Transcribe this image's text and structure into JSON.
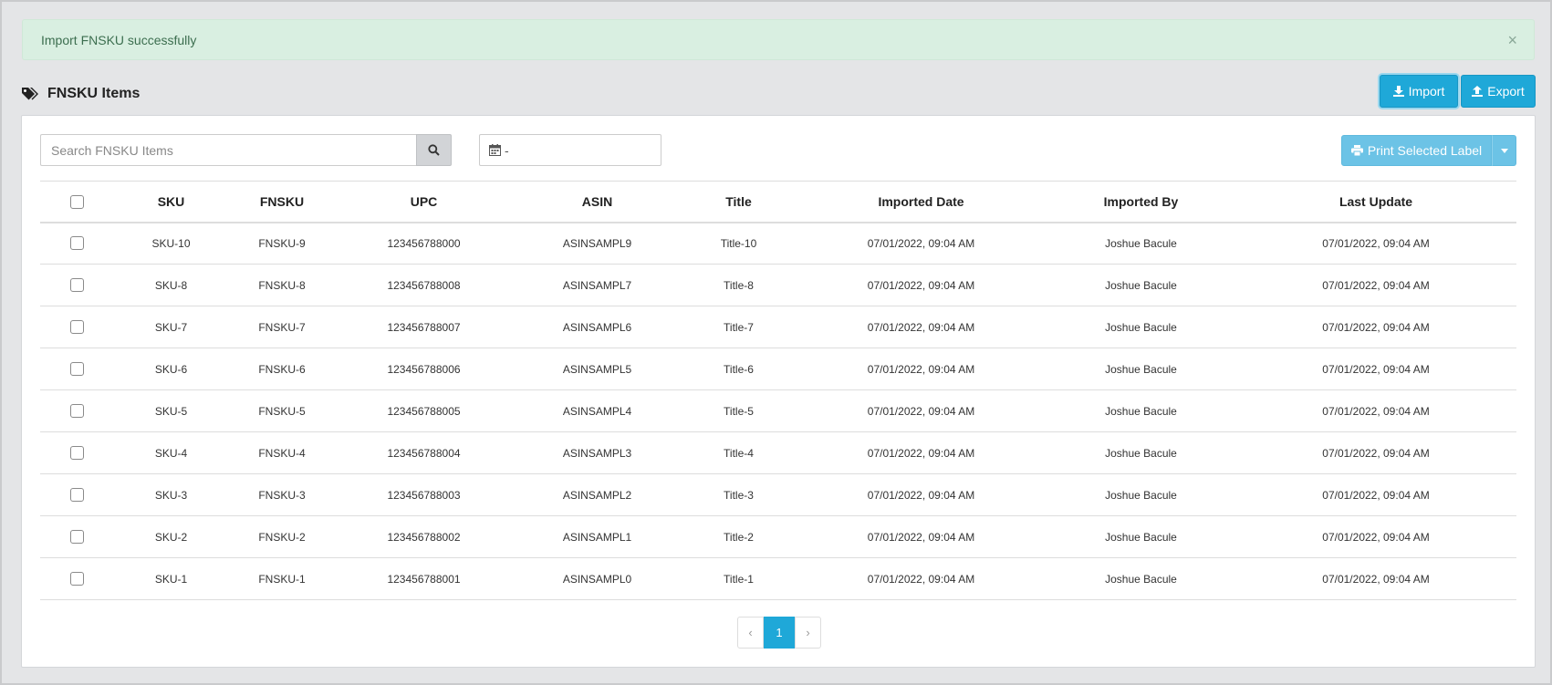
{
  "alert": {
    "message": "Import FNSKU successfully",
    "close": "×"
  },
  "section": {
    "title": "FNSKU Items"
  },
  "toolbar": {
    "import_label": "Import",
    "export_label": "Export"
  },
  "search": {
    "placeholder": "Search FNSKU Items",
    "value": ""
  },
  "date_range": {
    "value": "-"
  },
  "print": {
    "label": "Print Selected Label"
  },
  "table": {
    "columns": [
      "SKU",
      "FNSKU",
      "UPC",
      "ASIN",
      "Title",
      "Imported Date",
      "Imported By",
      "Last Update"
    ],
    "rows": [
      [
        "SKU-10",
        "FNSKU-9",
        "123456788000",
        "ASINSAMPL9",
        "Title-10",
        "07/01/2022, 09:04 AM",
        "Joshue Bacule",
        "07/01/2022, 09:04 AM"
      ],
      [
        "SKU-8",
        "FNSKU-8",
        "123456788008",
        "ASINSAMPL7",
        "Title-8",
        "07/01/2022, 09:04 AM",
        "Joshue Bacule",
        "07/01/2022, 09:04 AM"
      ],
      [
        "SKU-7",
        "FNSKU-7",
        "123456788007",
        "ASINSAMPL6",
        "Title-7",
        "07/01/2022, 09:04 AM",
        "Joshue Bacule",
        "07/01/2022, 09:04 AM"
      ],
      [
        "SKU-6",
        "FNSKU-6",
        "123456788006",
        "ASINSAMPL5",
        "Title-6",
        "07/01/2022, 09:04 AM",
        "Joshue Bacule",
        "07/01/2022, 09:04 AM"
      ],
      [
        "SKU-5",
        "FNSKU-5",
        "123456788005",
        "ASINSAMPL4",
        "Title-5",
        "07/01/2022, 09:04 AM",
        "Joshue Bacule",
        "07/01/2022, 09:04 AM"
      ],
      [
        "SKU-4",
        "FNSKU-4",
        "123456788004",
        "ASINSAMPL3",
        "Title-4",
        "07/01/2022, 09:04 AM",
        "Joshue Bacule",
        "07/01/2022, 09:04 AM"
      ],
      [
        "SKU-3",
        "FNSKU-3",
        "123456788003",
        "ASINSAMPL2",
        "Title-3",
        "07/01/2022, 09:04 AM",
        "Joshue Bacule",
        "07/01/2022, 09:04 AM"
      ],
      [
        "SKU-2",
        "FNSKU-2",
        "123456788002",
        "ASINSAMPL1",
        "Title-2",
        "07/01/2022, 09:04 AM",
        "Joshue Bacule",
        "07/01/2022, 09:04 AM"
      ],
      [
        "SKU-1",
        "FNSKU-1",
        "123456788001",
        "ASINSAMPL0",
        "Title-1",
        "07/01/2022, 09:04 AM",
        "Joshue Bacule",
        "07/01/2022, 09:04 AM"
      ]
    ]
  },
  "pagination": {
    "prev": "‹",
    "current": "1",
    "next": "›"
  },
  "icons": {
    "tags": "tags-icon",
    "import": "download-icon",
    "export": "upload-icon",
    "search": "search-icon",
    "calendar": "calendar-icon",
    "print": "print-icon",
    "dropdown": "caret-down-icon"
  },
  "colors": {
    "primary": "#1fa8d8",
    "print_button": "#6cc3e6",
    "alert_bg": "#d9efe1",
    "alert_text": "#3c6e4f"
  }
}
